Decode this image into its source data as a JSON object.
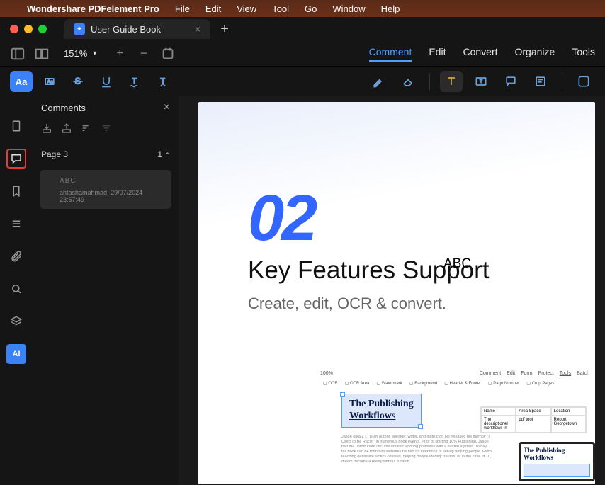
{
  "menubar": {
    "appname": "Wondershare PDFelement Pro",
    "items": [
      "File",
      "Edit",
      "View",
      "Tool",
      "Go",
      "Window",
      "Help"
    ]
  },
  "tab": {
    "title": "User Guide Book"
  },
  "zoom": {
    "value": "151%"
  },
  "modes": {
    "comment": "Comment",
    "edit": "Edit",
    "convert": "Convert",
    "organize": "Organize",
    "tools": "Tools"
  },
  "comments_panel": {
    "title": "Comments",
    "page_label": "Page 3",
    "count": "1",
    "card": {
      "text": "ABC",
      "author": "ahtashamahmad",
      "datetime": "29/07/2024 23:57:49"
    }
  },
  "document": {
    "number": "02",
    "annotation": "ABC",
    "heading": "Key Features Support",
    "subheading": "Create, edit, OCR & convert.",
    "subui": {
      "menus": [
        "Comment",
        "Edit",
        "Form",
        "Protect",
        "Tools",
        "Batch"
      ],
      "zoom": "100%",
      "tools": [
        "OCR",
        "OCR Area",
        "Watermark",
        "Background",
        "Header & Footer",
        "Page Number",
        "Crop Pages"
      ],
      "callout_line1": "The Publishing",
      "callout_line2": "Workflows",
      "table": {
        "headers": [
          "Name",
          "Area Space",
          "Location"
        ],
        "row": [
          "The descriptionel workflows in",
          "pdf tool",
          "Report Georgetown"
        ]
      },
      "bodytext": "Jason (aka Z L) is an author, speaker, writer, and instructor. He released his memoir \"I Used To Be Racist\" in numerous book events. Prior to starting 10% Publishing, Jason had the unfortunate circumstance of working promises with a hidden agenda. To day, his book can be found on websites he had no intentions of selling helping people. From teaching defensive tactics courses, helping people identify trauma, or in the case of 10, dream become a reality without a catch.",
      "preview_title": "The Publishing Workflows"
    }
  },
  "ai_label": "AI"
}
